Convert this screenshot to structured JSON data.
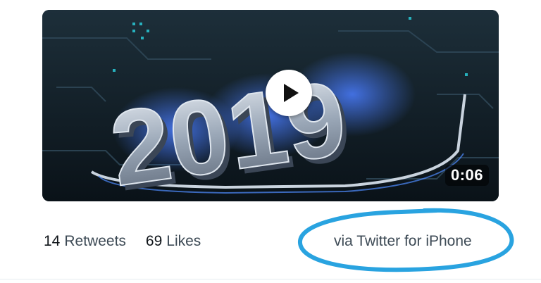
{
  "tweet": {
    "media": {
      "type": "video",
      "graphic_text": "2019",
      "duration": "0:06",
      "play_icon": "play-icon"
    },
    "stats": {
      "retweets_count": "14",
      "retweets_label": "Retweets",
      "likes_count": "69",
      "likes_label": "Likes"
    },
    "source": "via Twitter for iPhone"
  },
  "annotation": {
    "circle_color": "#29a3e0"
  },
  "colors": {
    "text_primary": "#0f1419",
    "text_secondary": "#3d4a55"
  }
}
